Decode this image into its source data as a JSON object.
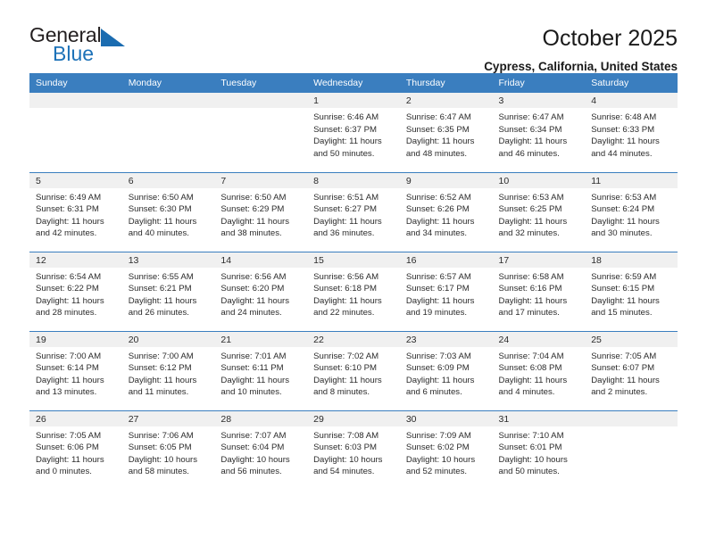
{
  "brand": {
    "name_top": "General",
    "name_bottom": "Blue",
    "accent_color": "#1b6cb0",
    "text_color": "#231f20"
  },
  "header": {
    "title": "October 2025",
    "subtitle": "Cypress, California, United States"
  },
  "calendar": {
    "header_bg": "#3a7ebf",
    "daynum_bg": "#f0f0f0",
    "weekday_headers": [
      "Sunday",
      "Monday",
      "Tuesday",
      "Wednesday",
      "Thursday",
      "Friday",
      "Saturday"
    ],
    "weeks": [
      [
        {
          "day": "",
          "empty": true
        },
        {
          "day": "",
          "empty": true
        },
        {
          "day": "",
          "empty": true
        },
        {
          "day": "1",
          "sunrise": "Sunrise: 6:46 AM",
          "sunset": "Sunset: 6:37 PM",
          "daylight1": "Daylight: 11 hours",
          "daylight2": "and 50 minutes."
        },
        {
          "day": "2",
          "sunrise": "Sunrise: 6:47 AM",
          "sunset": "Sunset: 6:35 PM",
          "daylight1": "Daylight: 11 hours",
          "daylight2": "and 48 minutes."
        },
        {
          "day": "3",
          "sunrise": "Sunrise: 6:47 AM",
          "sunset": "Sunset: 6:34 PM",
          "daylight1": "Daylight: 11 hours",
          "daylight2": "and 46 minutes."
        },
        {
          "day": "4",
          "sunrise": "Sunrise: 6:48 AM",
          "sunset": "Sunset: 6:33 PM",
          "daylight1": "Daylight: 11 hours",
          "daylight2": "and 44 minutes."
        }
      ],
      [
        {
          "day": "5",
          "sunrise": "Sunrise: 6:49 AM",
          "sunset": "Sunset: 6:31 PM",
          "daylight1": "Daylight: 11 hours",
          "daylight2": "and 42 minutes."
        },
        {
          "day": "6",
          "sunrise": "Sunrise: 6:50 AM",
          "sunset": "Sunset: 6:30 PM",
          "daylight1": "Daylight: 11 hours",
          "daylight2": "and 40 minutes."
        },
        {
          "day": "7",
          "sunrise": "Sunrise: 6:50 AM",
          "sunset": "Sunset: 6:29 PM",
          "daylight1": "Daylight: 11 hours",
          "daylight2": "and 38 minutes."
        },
        {
          "day": "8",
          "sunrise": "Sunrise: 6:51 AM",
          "sunset": "Sunset: 6:27 PM",
          "daylight1": "Daylight: 11 hours",
          "daylight2": "and 36 minutes."
        },
        {
          "day": "9",
          "sunrise": "Sunrise: 6:52 AM",
          "sunset": "Sunset: 6:26 PM",
          "daylight1": "Daylight: 11 hours",
          "daylight2": "and 34 minutes."
        },
        {
          "day": "10",
          "sunrise": "Sunrise: 6:53 AM",
          "sunset": "Sunset: 6:25 PM",
          "daylight1": "Daylight: 11 hours",
          "daylight2": "and 32 minutes."
        },
        {
          "day": "11",
          "sunrise": "Sunrise: 6:53 AM",
          "sunset": "Sunset: 6:24 PM",
          "daylight1": "Daylight: 11 hours",
          "daylight2": "and 30 minutes."
        }
      ],
      [
        {
          "day": "12",
          "sunrise": "Sunrise: 6:54 AM",
          "sunset": "Sunset: 6:22 PM",
          "daylight1": "Daylight: 11 hours",
          "daylight2": "and 28 minutes."
        },
        {
          "day": "13",
          "sunrise": "Sunrise: 6:55 AM",
          "sunset": "Sunset: 6:21 PM",
          "daylight1": "Daylight: 11 hours",
          "daylight2": "and 26 minutes."
        },
        {
          "day": "14",
          "sunrise": "Sunrise: 6:56 AM",
          "sunset": "Sunset: 6:20 PM",
          "daylight1": "Daylight: 11 hours",
          "daylight2": "and 24 minutes."
        },
        {
          "day": "15",
          "sunrise": "Sunrise: 6:56 AM",
          "sunset": "Sunset: 6:18 PM",
          "daylight1": "Daylight: 11 hours",
          "daylight2": "and 22 minutes."
        },
        {
          "day": "16",
          "sunrise": "Sunrise: 6:57 AM",
          "sunset": "Sunset: 6:17 PM",
          "daylight1": "Daylight: 11 hours",
          "daylight2": "and 19 minutes."
        },
        {
          "day": "17",
          "sunrise": "Sunrise: 6:58 AM",
          "sunset": "Sunset: 6:16 PM",
          "daylight1": "Daylight: 11 hours",
          "daylight2": "and 17 minutes."
        },
        {
          "day": "18",
          "sunrise": "Sunrise: 6:59 AM",
          "sunset": "Sunset: 6:15 PM",
          "daylight1": "Daylight: 11 hours",
          "daylight2": "and 15 minutes."
        }
      ],
      [
        {
          "day": "19",
          "sunrise": "Sunrise: 7:00 AM",
          "sunset": "Sunset: 6:14 PM",
          "daylight1": "Daylight: 11 hours",
          "daylight2": "and 13 minutes."
        },
        {
          "day": "20",
          "sunrise": "Sunrise: 7:00 AM",
          "sunset": "Sunset: 6:12 PM",
          "daylight1": "Daylight: 11 hours",
          "daylight2": "and 11 minutes."
        },
        {
          "day": "21",
          "sunrise": "Sunrise: 7:01 AM",
          "sunset": "Sunset: 6:11 PM",
          "daylight1": "Daylight: 11 hours",
          "daylight2": "and 10 minutes."
        },
        {
          "day": "22",
          "sunrise": "Sunrise: 7:02 AM",
          "sunset": "Sunset: 6:10 PM",
          "daylight1": "Daylight: 11 hours",
          "daylight2": "and 8 minutes."
        },
        {
          "day": "23",
          "sunrise": "Sunrise: 7:03 AM",
          "sunset": "Sunset: 6:09 PM",
          "daylight1": "Daylight: 11 hours",
          "daylight2": "and 6 minutes."
        },
        {
          "day": "24",
          "sunrise": "Sunrise: 7:04 AM",
          "sunset": "Sunset: 6:08 PM",
          "daylight1": "Daylight: 11 hours",
          "daylight2": "and 4 minutes."
        },
        {
          "day": "25",
          "sunrise": "Sunrise: 7:05 AM",
          "sunset": "Sunset: 6:07 PM",
          "daylight1": "Daylight: 11 hours",
          "daylight2": "and 2 minutes."
        }
      ],
      [
        {
          "day": "26",
          "sunrise": "Sunrise: 7:05 AM",
          "sunset": "Sunset: 6:06 PM",
          "daylight1": "Daylight: 11 hours",
          "daylight2": "and 0 minutes."
        },
        {
          "day": "27",
          "sunrise": "Sunrise: 7:06 AM",
          "sunset": "Sunset: 6:05 PM",
          "daylight1": "Daylight: 10 hours",
          "daylight2": "and 58 minutes."
        },
        {
          "day": "28",
          "sunrise": "Sunrise: 7:07 AM",
          "sunset": "Sunset: 6:04 PM",
          "daylight1": "Daylight: 10 hours",
          "daylight2": "and 56 minutes."
        },
        {
          "day": "29",
          "sunrise": "Sunrise: 7:08 AM",
          "sunset": "Sunset: 6:03 PM",
          "daylight1": "Daylight: 10 hours",
          "daylight2": "and 54 minutes."
        },
        {
          "day": "30",
          "sunrise": "Sunrise: 7:09 AM",
          "sunset": "Sunset: 6:02 PM",
          "daylight1": "Daylight: 10 hours",
          "daylight2": "and 52 minutes."
        },
        {
          "day": "31",
          "sunrise": "Sunrise: 7:10 AM",
          "sunset": "Sunset: 6:01 PM",
          "daylight1": "Daylight: 10 hours",
          "daylight2": "and 50 minutes."
        },
        {
          "day": "",
          "empty": true
        }
      ]
    ]
  }
}
